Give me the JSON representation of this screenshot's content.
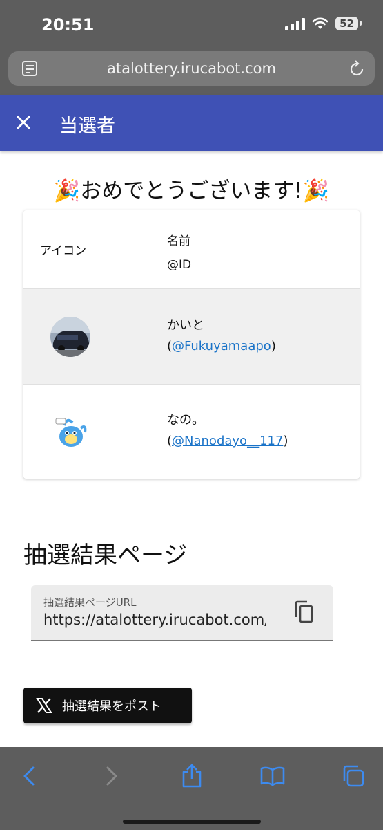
{
  "status_bar": {
    "time": "20:51",
    "battery": "52"
  },
  "browser": {
    "url": "atalottery.irucabot.com"
  },
  "app_bar": {
    "title": "当選者"
  },
  "content": {
    "congrats": "🎉おめでとうございます!🎉",
    "table": {
      "col_icon": "アイコン",
      "col_name": "名前",
      "col_id": "@ID",
      "rows": [
        {
          "name": "かいと",
          "open": "(",
          "handle": "@Fukuyamaapo",
          "close": ")"
        },
        {
          "name": "なの。",
          "open": "(",
          "handle": "@Nanodayo__117",
          "close": ")"
        }
      ]
    },
    "results_section": {
      "heading": "抽選結果ページ",
      "url_label": "抽選結果ページURL",
      "url_value": "https://atalottery.irucabot.com/re"
    },
    "post_button": "抽選結果をポスト"
  },
  "colors": {
    "app_bar": "#3f51b5",
    "link": "#1a73c8",
    "toolbar_icon": "#3d8bf0"
  }
}
